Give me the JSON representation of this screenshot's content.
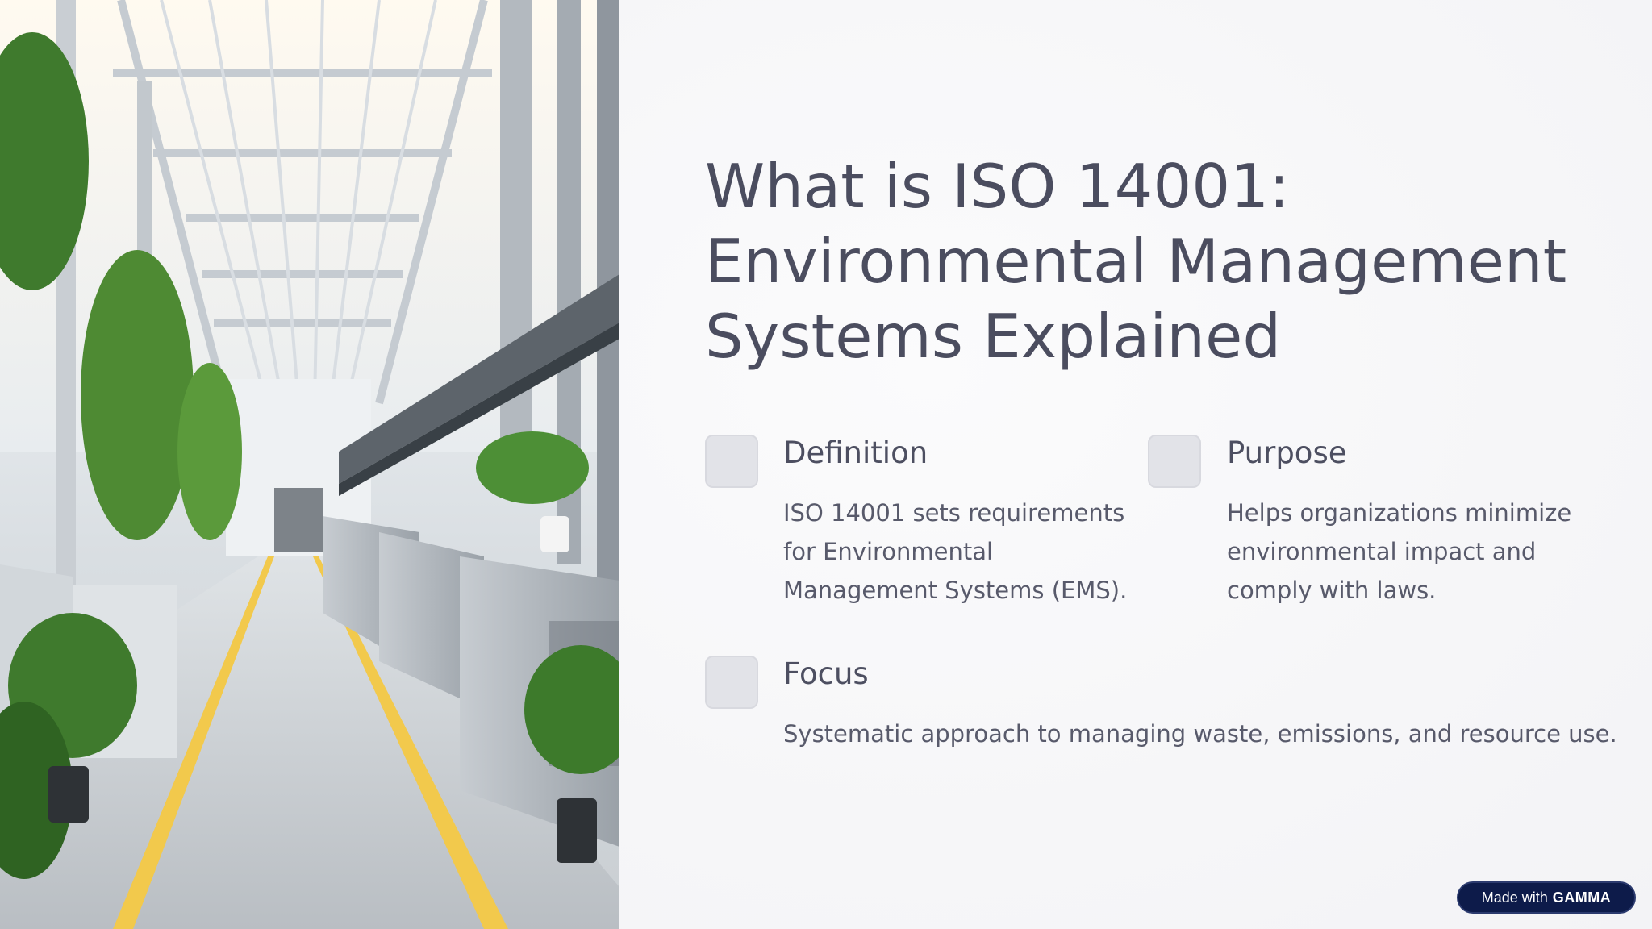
{
  "slide": {
    "title": "What is ISO 14001:\nEnvironmental Management\nSystems Explained"
  },
  "items": [
    {
      "heading": "Definition",
      "text": "ISO 14001 sets requirements\nfor Environmental\nManagement Systems (EMS)."
    },
    {
      "heading": "Purpose",
      "text": "Helps organizations minimize\nenvironmental impact and\ncomply with laws."
    },
    {
      "heading": "Focus",
      "text": "Systematic approach to managing waste, emissions, and resource use."
    }
  ],
  "badge": {
    "prefix": "Made with",
    "brand": "GAMMA"
  },
  "colors": {
    "title": "#4b4d5f",
    "icon_box": "#e2e3e8",
    "badge_bg": "#0d1b4a",
    "floor_stripe": "#f2c94c"
  },
  "image": {
    "subject": "bright factory hall with plants"
  }
}
